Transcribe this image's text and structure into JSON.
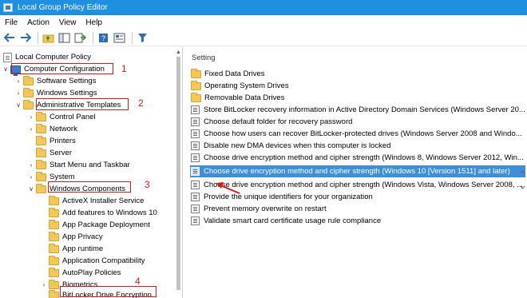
{
  "window": {
    "title": "Local Group Policy Editor"
  },
  "menu": [
    "File",
    "Action",
    "View",
    "Help"
  ],
  "toolbar": {
    "buttons": [
      "back-icon",
      "forward-icon",
      "up-folder-icon",
      "show-hide-tree-icon",
      "export-list-icon",
      "help-icon",
      "properties-icon",
      "filter-icon"
    ]
  },
  "tree": {
    "root": "Local Computer Policy",
    "computer_config": "Computer Configuration",
    "software_settings": "Software Settings",
    "windows_settings": "Windows Settings",
    "admin_templates": "Administrative Templates",
    "control_panel": "Control Panel",
    "network": "Network",
    "printers": "Printers",
    "server": "Server",
    "start_menu": "Start Menu and Taskbar",
    "system": "System",
    "windows_components": "Windows Components",
    "activex": "ActiveX Installer Service",
    "add_features": "Add features to Windows 10",
    "app_package": "App Package Deployment",
    "app_privacy": "App Privacy",
    "app_runtime": "App runtime",
    "app_compat": "Application Compatibility",
    "autoplay": "AutoPlay Policies",
    "biometrics": "Biometrics",
    "bitlocker": "BitLocker Drive Encryption"
  },
  "settings": {
    "header": "Setting",
    "folders": [
      "Fixed Data Drives",
      "Operating System Drives",
      "Removable Data Drives"
    ],
    "items": [
      "Store BitLocker recovery information in Active Directory Domain Services (Windows Server 20...",
      "Choose default folder for recovery password",
      "Choose how users can recover BitLocker-protected drives (Windows Server 2008 and Windo...",
      "Disable new DMA devices when this computer is locked",
      "Choose drive encryption method and cipher strength (Windows 8, Windows Server 2012, Win...",
      "Choose drive encryption method and cipher strength (Windows 10 [Version 1511] and later)",
      "Choose drive encryption method and cipher strength (Windows Vista, Windows Server 2008, ...",
      "Provide the unique identifiers for your organization",
      "Prevent memory overwrite on restart",
      "Validate smart card certificate usage rule compliance"
    ]
  },
  "callouts": [
    "1",
    "2",
    "3",
    "4"
  ],
  "colors": {
    "titlebar": "#1f8fe0",
    "selection": "#3e8ed8",
    "annotation": "#d21a1a",
    "folder": "#f4c75a"
  }
}
